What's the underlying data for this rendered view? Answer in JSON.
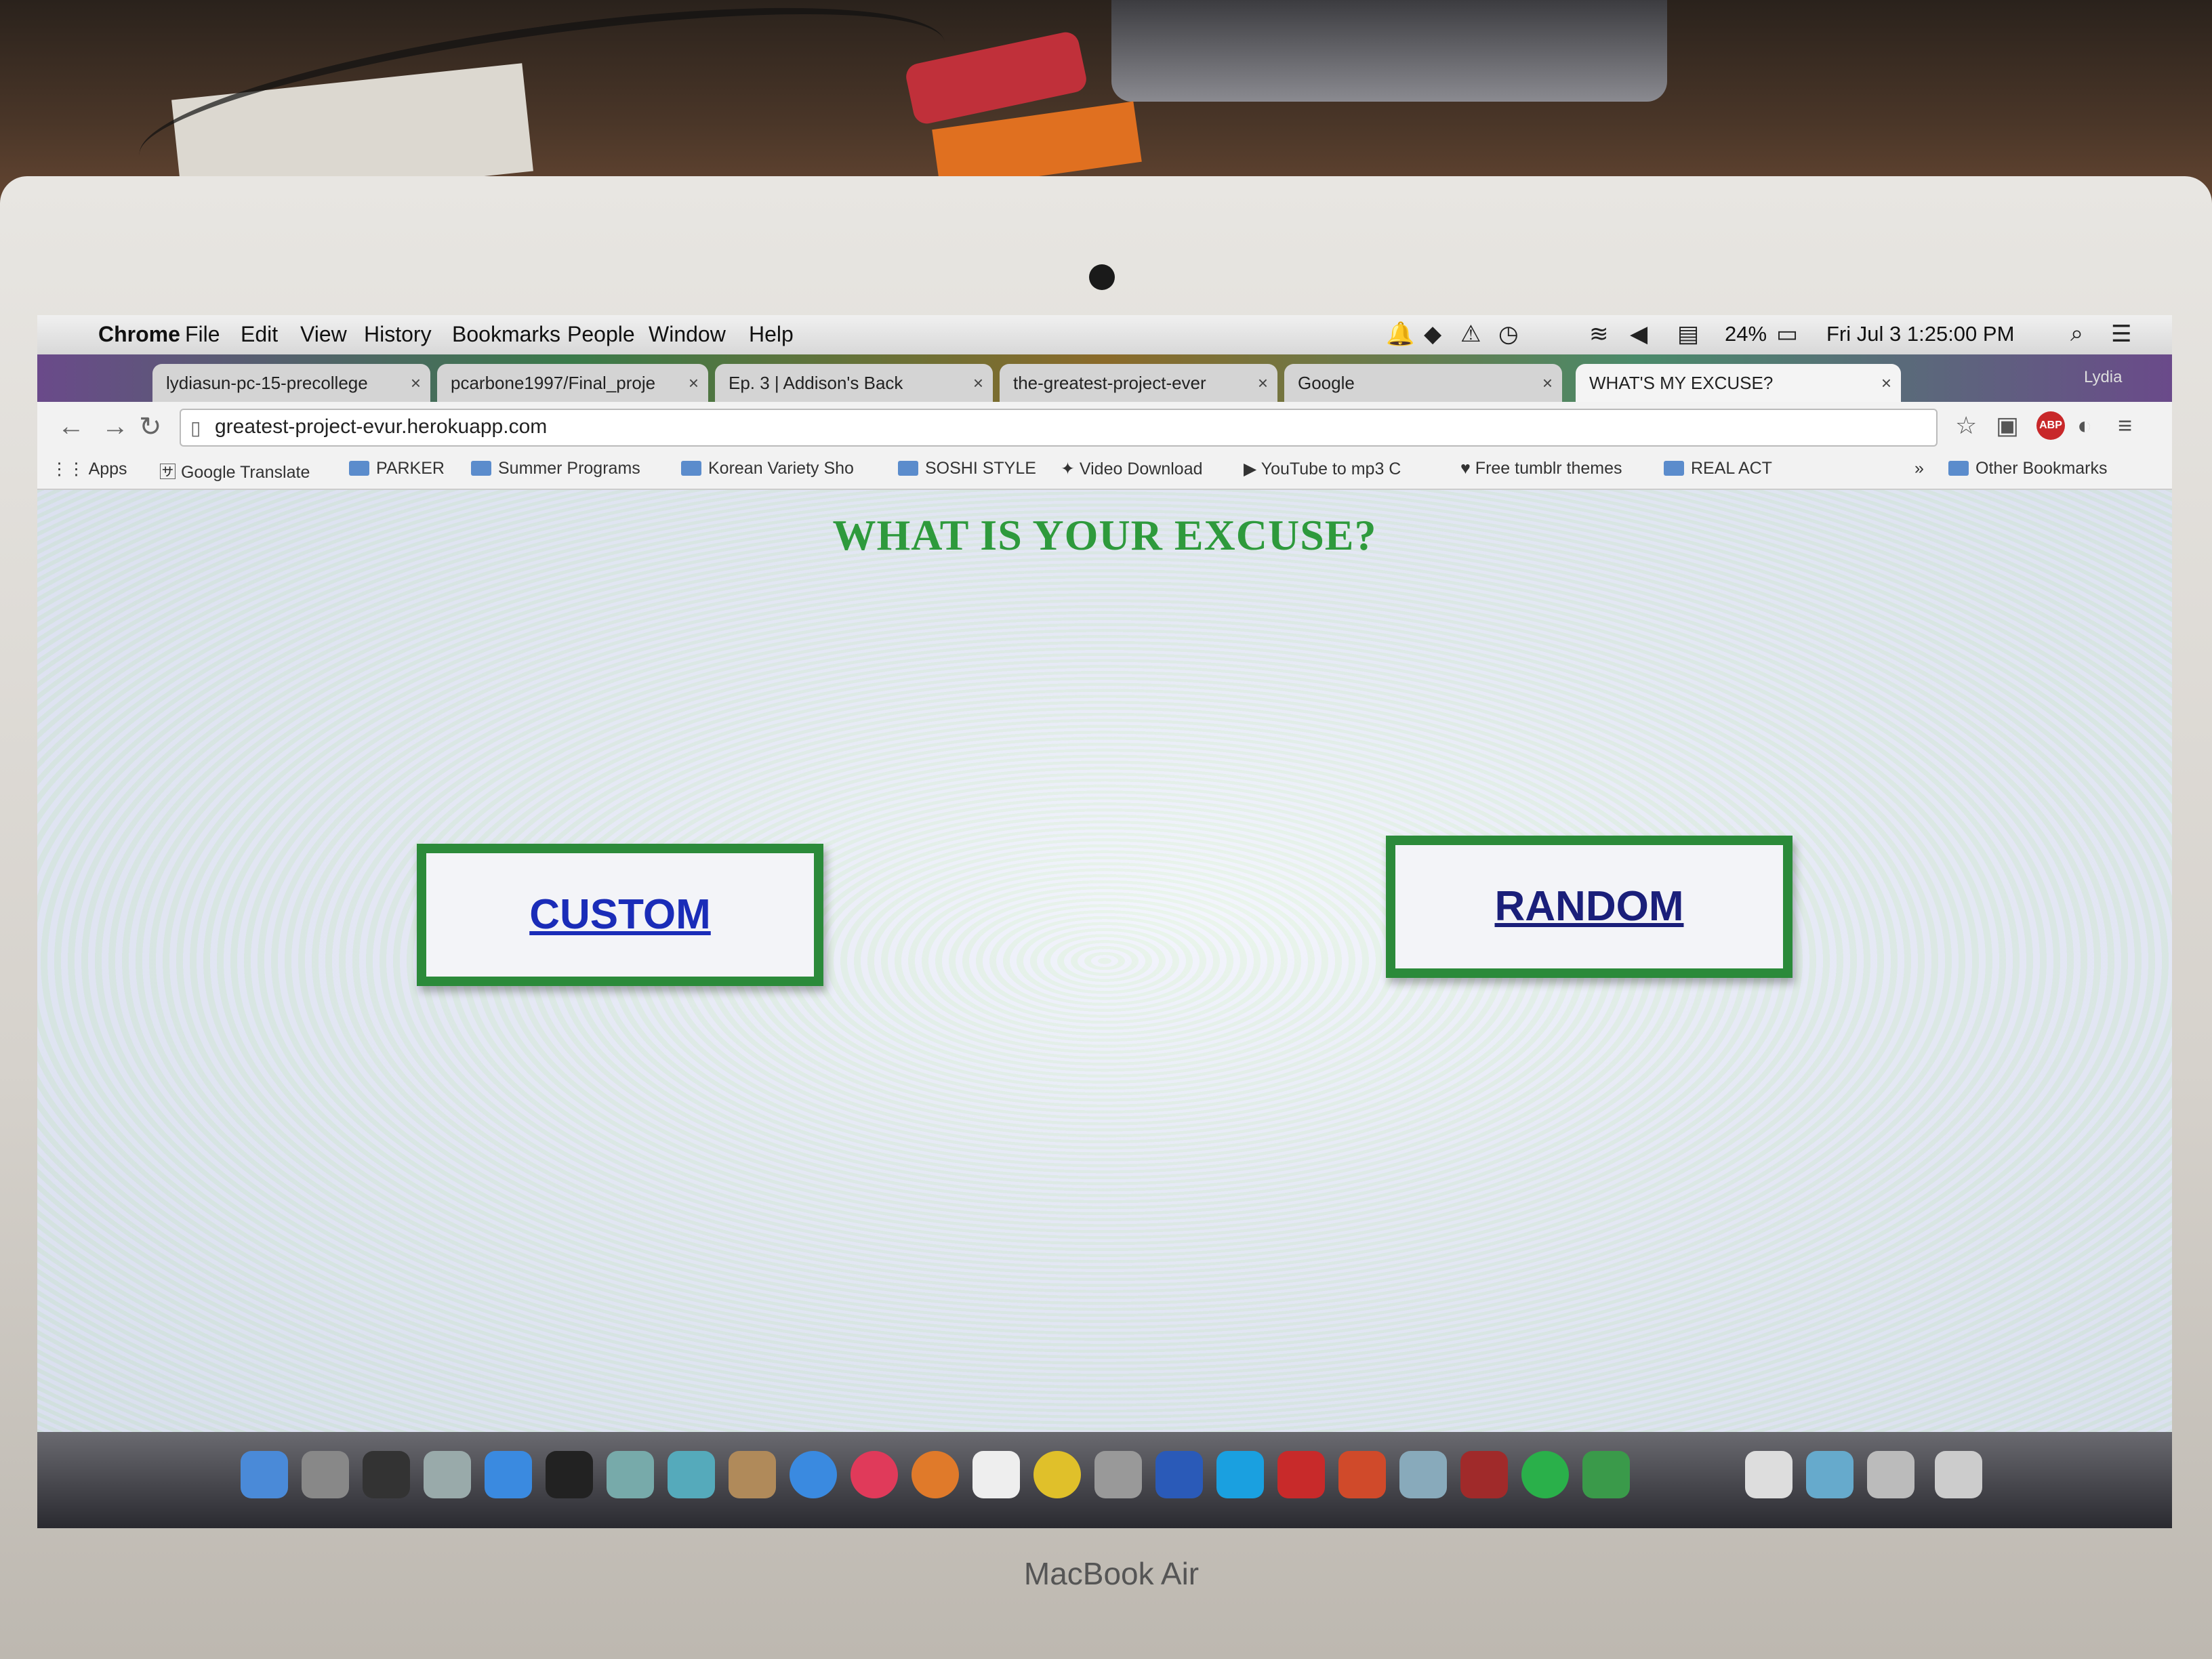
{
  "menubar": {
    "app_name": "Chrome",
    "menus": [
      "File",
      "Edit",
      "View",
      "History",
      "Bookmarks",
      "People",
      "Window",
      "Help"
    ],
    "battery": "24%",
    "datetime": "Fri Jul 3  1:25:00 PM"
  },
  "tabs": [
    {
      "label": "lydiasun-pc-15-precollege"
    },
    {
      "label": "pcarbone1997/Final_proje"
    },
    {
      "label": "Ep. 3 | Addison's Back"
    },
    {
      "label": "the-greatest-project-ever"
    },
    {
      "label": "Google"
    },
    {
      "label": "WHAT'S MY EXCUSE?"
    }
  ],
  "profile_name": "Lydia",
  "address_bar": {
    "url": "greatest-project-evur.herokuapp.com"
  },
  "bookmarks": [
    {
      "label": "Apps"
    },
    {
      "label": "Google Translate"
    },
    {
      "label": "PARKER"
    },
    {
      "label": "Summer Programs"
    },
    {
      "label": "Korean Variety Sho"
    },
    {
      "label": "SOSHI STYLE"
    },
    {
      "label": "Video Download"
    },
    {
      "label": "YouTube to mp3 C"
    },
    {
      "label": "Free tumblr themes"
    },
    {
      "label": "REAL ACT"
    },
    {
      "label": "Other Bookmarks"
    }
  ],
  "page": {
    "heading": "WHAT IS YOUR EXCUSE?",
    "custom_button": "CUSTOM",
    "random_button": "RANDOM"
  },
  "device": {
    "brand": "MacBook Air"
  },
  "colors": {
    "heading": "#2e9a3c",
    "button_border": "#2b8a3a",
    "link": "#1a2cb8"
  }
}
